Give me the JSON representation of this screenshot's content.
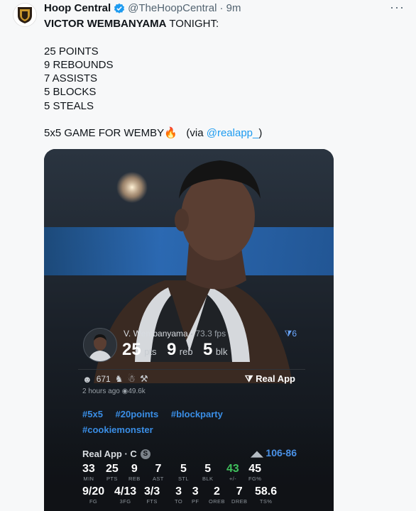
{
  "tweet": {
    "author_name": "Hoop Central",
    "handle": "@TheHoopCentral",
    "time": "· 9m",
    "more": "···",
    "text_head_bold": "VICTOR WEMBANYAMA",
    "text_head_rest": " TONIGHT:",
    "stat_lines": [
      "25 POINTS",
      "9 REBOUNDS",
      "7 ASSISTS",
      "5 BLOCKS",
      "5 STEALS"
    ],
    "closing_text": "5x5 GAME FOR WEMBY",
    "closing_emoji": "🔥",
    "via_prefix": "   (via ",
    "via_link": "@realapp_",
    "via_suffix": ")"
  },
  "card": {
    "player_name": "V. Wembanyama",
    "fps": " · 73.3 fps",
    "filter_label": "6",
    "big_stats": [
      {
        "value": "25",
        "label": "pts"
      },
      {
        "value": "9",
        "label": "reb"
      },
      {
        "value": "5",
        "label": "blk"
      }
    ],
    "likes": "671",
    "real_app_label": "Real App",
    "time_ago": "2 hours ago",
    "views": "49.6k",
    "hashtags_line1": [
      "#5x5",
      "#20points",
      "#blockparty"
    ],
    "hashtags_line2": "#cookiemonster",
    "team_label": "Real App · C",
    "team_badge": "S",
    "score": "106-86",
    "stats_row1": [
      {
        "value": "33",
        "label": "MIN"
      },
      {
        "value": "25",
        "label": "PTS"
      },
      {
        "value": "9",
        "label": "REB"
      },
      {
        "value": "7",
        "label": "AST"
      },
      {
        "value": "5",
        "label": "STL"
      },
      {
        "value": "5",
        "label": "BLK"
      },
      {
        "value": "43",
        "label": "+/-"
      },
      {
        "value": "45",
        "label": "FG%"
      }
    ],
    "stats_row2": [
      {
        "value": "9/20",
        "label": "FG"
      },
      {
        "value": "4/13",
        "label": "3FG"
      },
      {
        "value": "3/3",
        "label": "FTS"
      },
      {
        "value": "3",
        "label": "TO"
      },
      {
        "value": "3",
        "label": "PF"
      },
      {
        "value": "2",
        "label": "OREB"
      },
      {
        "value": "7",
        "label": "DREB"
      },
      {
        "value": "58.6",
        "label": "TS%"
      }
    ]
  },
  "colors": {
    "link": "#1d9bf0",
    "verified": "#1d9bf0",
    "accent_blue": "#4a91e6",
    "positive_green": "#3fbf5c"
  }
}
